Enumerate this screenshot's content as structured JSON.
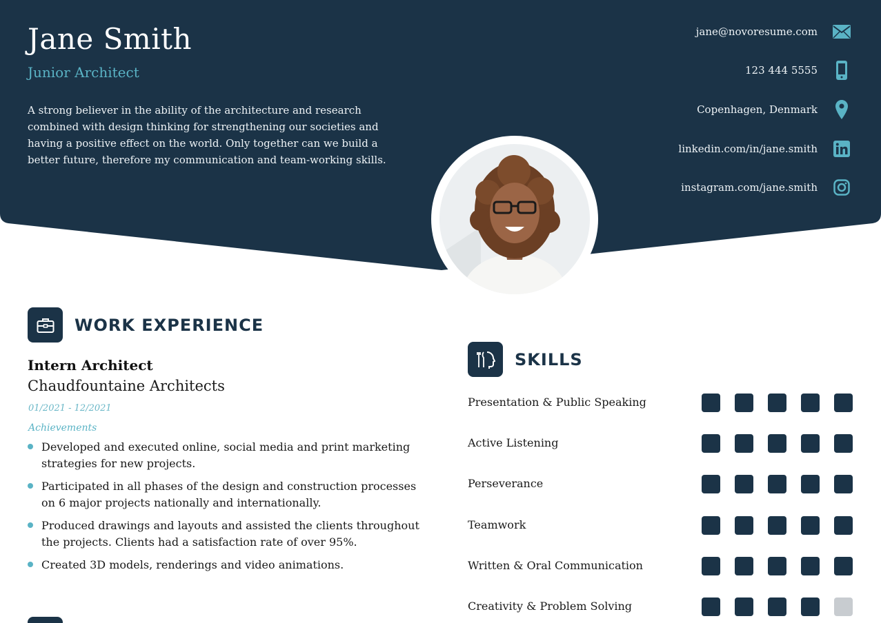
{
  "profile": {
    "name": "Jane Smith",
    "role": "Junior Architect",
    "summary": "A strong believer in the ability of the architecture and research combined with design thinking for strengthening our societies and having a positive effect on the world. Only together can we build a better future, therefore my communication and team-working skills."
  },
  "contact": {
    "email": "jane@novoresume.com",
    "phone": "123 444 5555",
    "location": "Copenhagen, Denmark",
    "linkedin": "linkedin.com/in/jane.smith",
    "instagram": "instagram.com/jane.smith"
  },
  "work": {
    "section_title": "WORK EXPERIENCE",
    "job_title": "Intern Architect",
    "company": "Chaudfountaine Architects",
    "dates": "01/2021 - 12/2021",
    "achievements_label": "Achievements",
    "bullets": [
      "Developed and executed online, social media and print marketing strategies for new projects.",
      "Participated in all phases of the design and construction processes on 6 major projects nationally and internationally.",
      "Produced drawings and layouts and assisted the clients throughout the projects. Clients had a satisfaction rate of over 95%.",
      "Created 3D models, renderings and video animations."
    ]
  },
  "skills": {
    "section_title": "SKILLS",
    "max_level": 5,
    "items": [
      {
        "name": "Presentation & Public Speaking",
        "level": 5
      },
      {
        "name": "Active Listening",
        "level": 5
      },
      {
        "name": "Perseverance",
        "level": 5
      },
      {
        "name": "Teamwork",
        "level": 5
      },
      {
        "name": "Written & Oral Communication",
        "level": 5
      },
      {
        "name": "Creativity & Problem Solving",
        "level": 4
      }
    ]
  },
  "colors": {
    "header": "#1b3347",
    "accent": "#5ab3c5",
    "level_on": "#1b3347",
    "level_off": "#c8ccd0"
  },
  "icons": {
    "email": "envelope-icon",
    "phone": "mobile-phone-icon",
    "location": "map-pin-icon",
    "linkedin": "linkedin-icon",
    "instagram": "instagram-icon",
    "work": "briefcase-icon",
    "skills": "head-tools-icon"
  }
}
